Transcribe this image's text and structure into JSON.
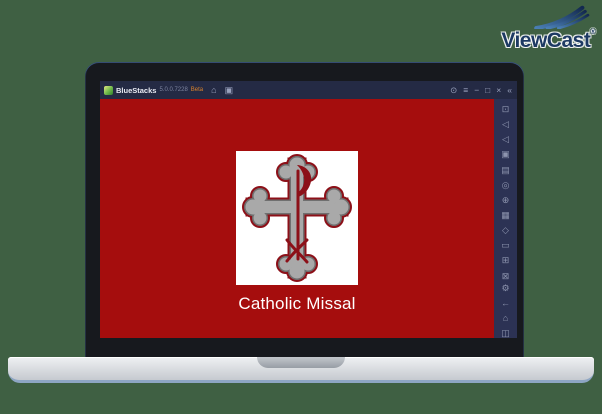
{
  "brand": {
    "name": "ViewCast",
    "registered": "®"
  },
  "titlebar": {
    "app_name": "BlueStacks",
    "version": "5.0.0.7228",
    "beta_label": "Beta",
    "tabs": [
      {
        "name": "home-tab",
        "glyph": "⌂"
      },
      {
        "name": "app-tab",
        "glyph": "▣"
      }
    ],
    "window_controls": [
      {
        "name": "info",
        "glyph": "⊙"
      },
      {
        "name": "menu",
        "glyph": "≡"
      },
      {
        "name": "minimize",
        "glyph": "−"
      },
      {
        "name": "maximize",
        "glyph": "□"
      },
      {
        "name": "close",
        "glyph": "×"
      },
      {
        "name": "collapse-sidebar",
        "glyph": "«"
      }
    ]
  },
  "app_screen": {
    "app_title": "Catholic Missal",
    "background_color": "#a50d0d",
    "logo_colors": {
      "tile": "#ffffff",
      "cross_fill": "#a9a9a9",
      "cross_inner_edge": "#6f6f6f",
      "cross_outline": "#8c1018"
    }
  },
  "sidebar": {
    "icons": [
      {
        "name": "fullscreen",
        "glyph": "⊡"
      },
      {
        "name": "volume-up",
        "glyph": "◁"
      },
      {
        "name": "volume-down",
        "glyph": "◁"
      },
      {
        "name": "screenshot",
        "glyph": "▣"
      },
      {
        "name": "screen-recorder",
        "glyph": "▤"
      },
      {
        "name": "location",
        "glyph": "◎"
      },
      {
        "name": "install-apk",
        "glyph": "⊕"
      },
      {
        "name": "media-manager",
        "glyph": "▦"
      },
      {
        "name": "macro-recorder",
        "glyph": "◇"
      },
      {
        "name": "folder",
        "glyph": "▭"
      },
      {
        "name": "multi-instance",
        "glyph": "⊞"
      },
      {
        "name": "game-controls",
        "glyph": "⊠"
      }
    ],
    "bottom_icons": [
      {
        "name": "settings",
        "glyph": "⚙"
      },
      {
        "name": "back",
        "glyph": "←"
      },
      {
        "name": "home",
        "glyph": "⌂"
      },
      {
        "name": "recent-apps",
        "glyph": "◫"
      }
    ]
  },
  "colors": {
    "page_background": "#3f6043",
    "brand_navy": "#1d3a63",
    "titlebar_background": "#242a44",
    "sidebar_background": "#2c3254",
    "app_red": "#a50d0d",
    "beta_orange": "#d9822b"
  }
}
